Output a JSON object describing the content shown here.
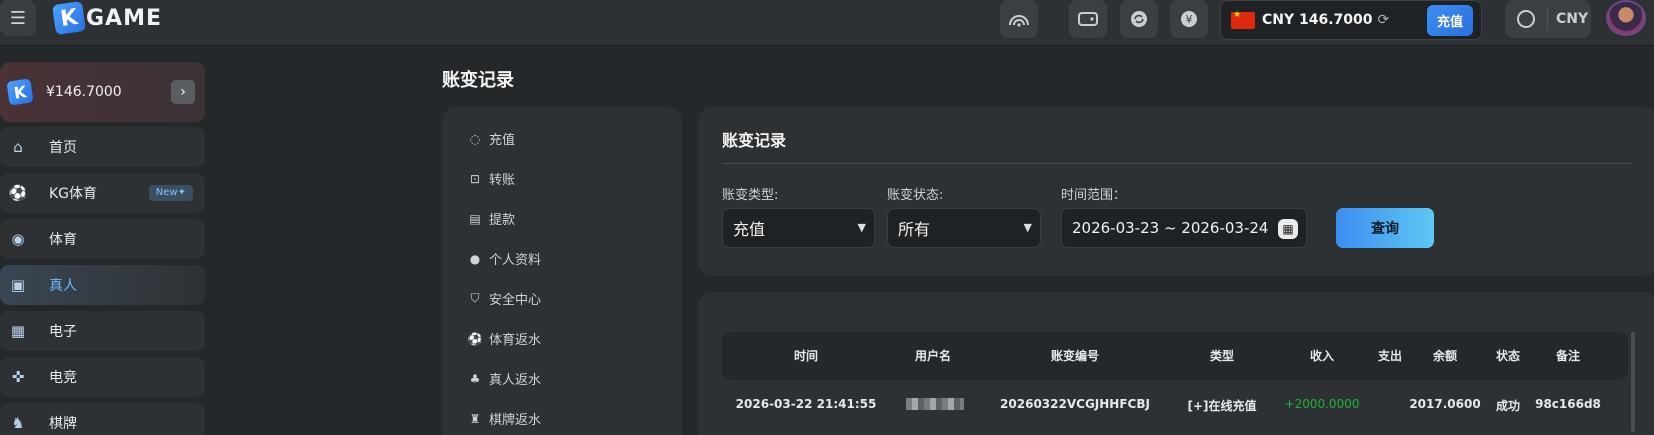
{
  "header": {
    "logo_text": "GAME",
    "logo_letter": "K",
    "balance": "CNY 146.7000",
    "recharge_label": "充值",
    "currency": "CNY"
  },
  "sidebar": {
    "wallet_balance": "¥146.7000",
    "items": [
      {
        "label": "首页",
        "icon": "home-icon"
      },
      {
        "label": "KG体育",
        "icon": "soccer-ball-icon",
        "badge": "New✦"
      },
      {
        "label": "体育",
        "icon": "basketball-icon"
      },
      {
        "label": "真人",
        "icon": "cards-icon",
        "active": true
      },
      {
        "label": "电子",
        "icon": "slot-machine-icon"
      },
      {
        "label": "电竞",
        "icon": "gamepad-icon"
      },
      {
        "label": "棋牌",
        "icon": "chess-icon"
      }
    ]
  },
  "page": {
    "title": "账变记录"
  },
  "account_menu": {
    "items": [
      {
        "label": "充值",
        "icon": "piggy-bank-icon"
      },
      {
        "label": "转账",
        "icon": "transfer-icon"
      },
      {
        "label": "提款",
        "icon": "withdraw-icon"
      },
      {
        "label": "个人资料",
        "icon": "user-icon"
      },
      {
        "label": "安全中心",
        "icon": "shield-icon"
      },
      {
        "label": "体育返水",
        "icon": "soccer-icon"
      },
      {
        "label": "真人返水",
        "icon": "people-icon"
      },
      {
        "label": "棋牌返水",
        "icon": "chess-piece-icon"
      }
    ]
  },
  "filter": {
    "panel_title": "账变记录",
    "type_label": "账变类型:",
    "type_value": "充值",
    "status_label": "账变状态:",
    "status_value": "所有",
    "date_label": "时间范围：",
    "date_value": "2026-03-23 ~ 2026-03-24",
    "query_label": "查询"
  },
  "table": {
    "headers": [
      "时间",
      "用户名",
      "账变编号",
      "类型",
      "收入",
      "支出",
      "余额",
      "状态",
      "备注"
    ],
    "rows": [
      {
        "time": "2026-03-22 21:41:55",
        "serial": "20260322VCGJHHFCBJ",
        "type": "[+]在线充值",
        "income": "+2000.0000",
        "expense": "",
        "balance": "2017.0600",
        "status": "成功",
        "remark": "98c166d8"
      }
    ]
  },
  "colors": {
    "accent": "#3d8ef0",
    "income_green": "#1bb03a",
    "active_nav_text": "#6eb6ff"
  }
}
